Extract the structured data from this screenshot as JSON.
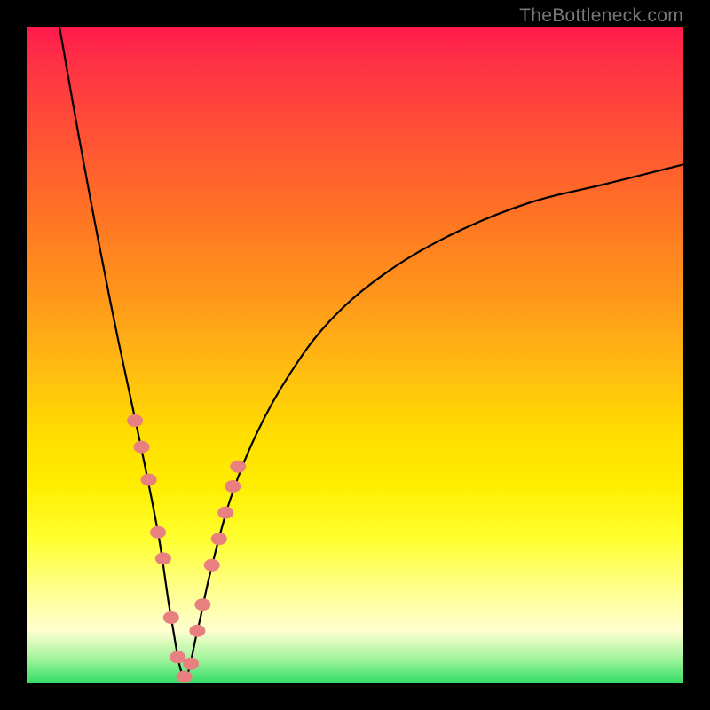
{
  "watermark": "TheBottleneck.com",
  "chart_data": {
    "type": "line",
    "title": "",
    "xlabel": "",
    "ylabel": "",
    "xlim": [
      0,
      100
    ],
    "ylim": [
      0,
      100
    ],
    "description": "V-shaped bottleneck curve over rainbow gradient; minimum at x≈24 (green zone). Left branch rises steeply to top-left, right branch rises asymptotically toward ~79 at right edge.",
    "series": [
      {
        "name": "bottleneck-curve",
        "x": [
          5,
          8,
          11,
          14,
          17,
          20,
          22,
          24,
          26,
          28,
          31,
          35,
          40,
          46,
          54,
          64,
          76,
          88,
          100
        ],
        "y": [
          100,
          83,
          67,
          52,
          38,
          23,
          10,
          1,
          8,
          17,
          28,
          38,
          47,
          55,
          62,
          68,
          73,
          76,
          79
        ]
      }
    ],
    "marker_points": {
      "note": "salmon dots overlaid on curve in lower band",
      "x": [
        16.5,
        17.5,
        18.6,
        20.0,
        20.8,
        22.0,
        23.0,
        24.0,
        25.0,
        26.0,
        26.8,
        28.2,
        29.3,
        30.3,
        31.4,
        32.2
      ],
      "y": [
        40,
        36,
        31,
        23,
        19,
        10,
        4,
        1,
        3,
        8,
        12,
        18,
        22,
        26,
        30,
        33
      ]
    },
    "gradient_colors": {
      "top": "#ff1a4d",
      "mid_upper": "#ff7722",
      "mid": "#ffdd00",
      "mid_lower": "#ffff90",
      "bottom": "#33dd66"
    }
  }
}
